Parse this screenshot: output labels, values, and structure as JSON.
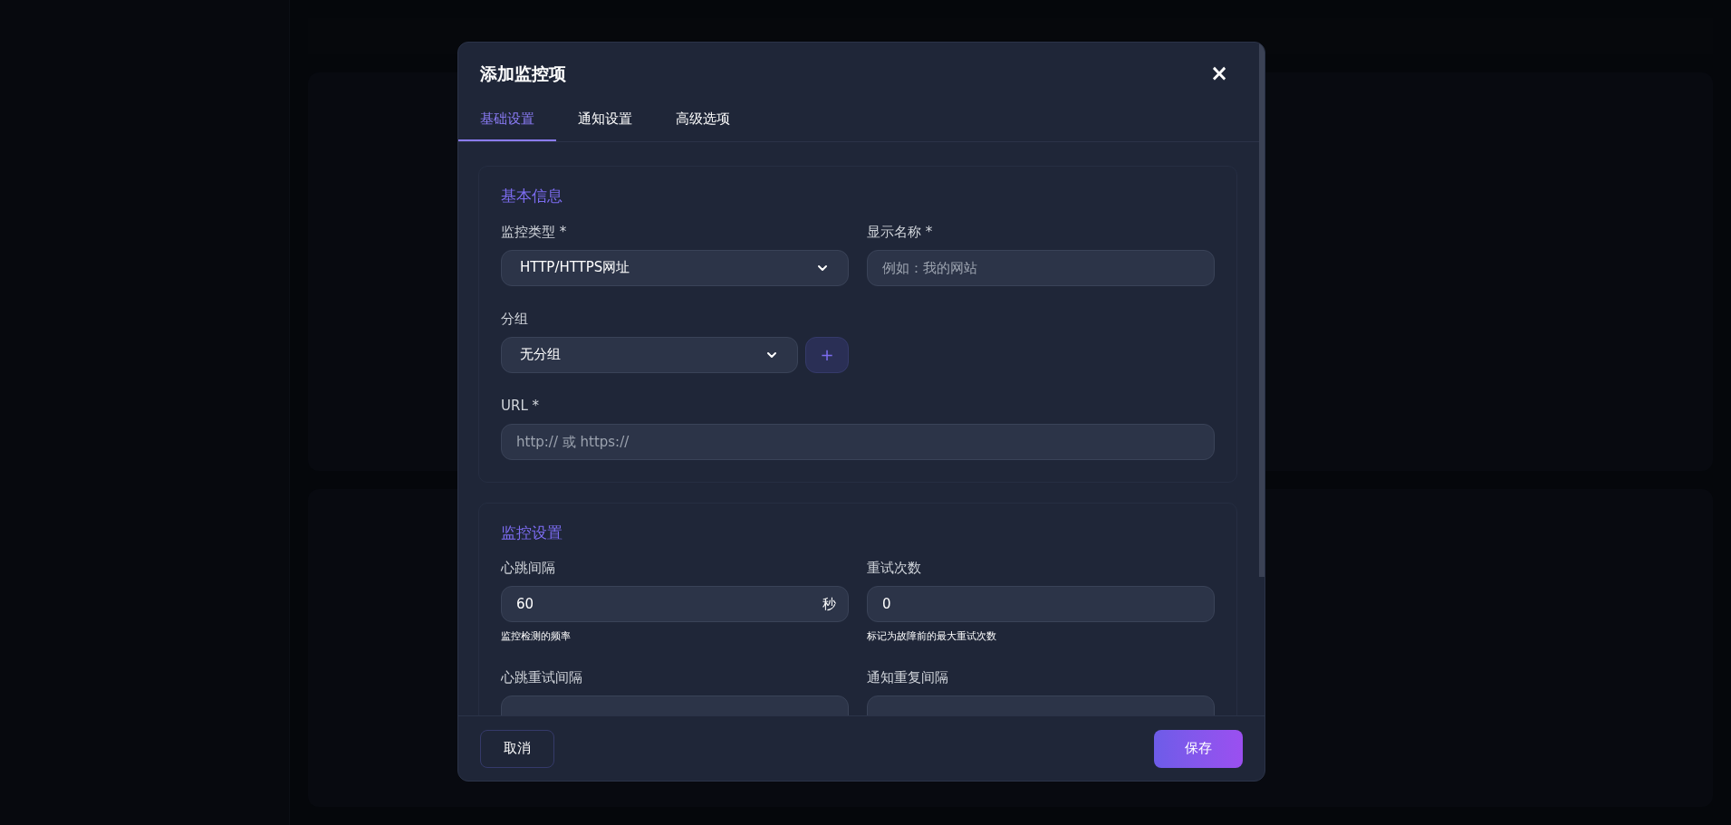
{
  "dialog": {
    "title": "添加监控项",
    "close": "×",
    "tabs": [
      {
        "label": "基础设置",
        "selected": true
      },
      {
        "label": "通知设置",
        "selected": false
      },
      {
        "label": "高级选项",
        "selected": false
      }
    ],
    "sections": [
      {
        "title": "基本信息",
        "fields": [
          {
            "label": "监控类型 *",
            "kind": "select",
            "value": "HTTP/HTTPS网址",
            "wide": false
          },
          {
            "label": "显示名称 *",
            "kind": "input",
            "placeholder": "例如：我的网站",
            "wide": false
          },
          {
            "label": "分组",
            "kind": "select_add",
            "value": "无分组",
            "add": "+",
            "wide": false
          },
          {
            "label": "URL *",
            "kind": "input",
            "placeholder": "http:// 或 https://",
            "wide": true
          }
        ]
      },
      {
        "title": "监控设置",
        "fields": [
          {
            "label": "心跳间隔",
            "kind": "input",
            "value": "60",
            "suffix": "秒",
            "hint": "监控检测的频率",
            "wide": false
          },
          {
            "label": "重试次数",
            "kind": "input",
            "value": "0",
            "hint": "标记为故障前的最大重试次数",
            "wide": false
          },
          {
            "label": "心跳重试间隔",
            "kind": "input",
            "wide": false
          },
          {
            "label": "通知重复间隔",
            "kind": "input",
            "wide": false
          }
        ]
      }
    ],
    "buttons": {
      "cancel": "取消",
      "save": "保存"
    }
  }
}
